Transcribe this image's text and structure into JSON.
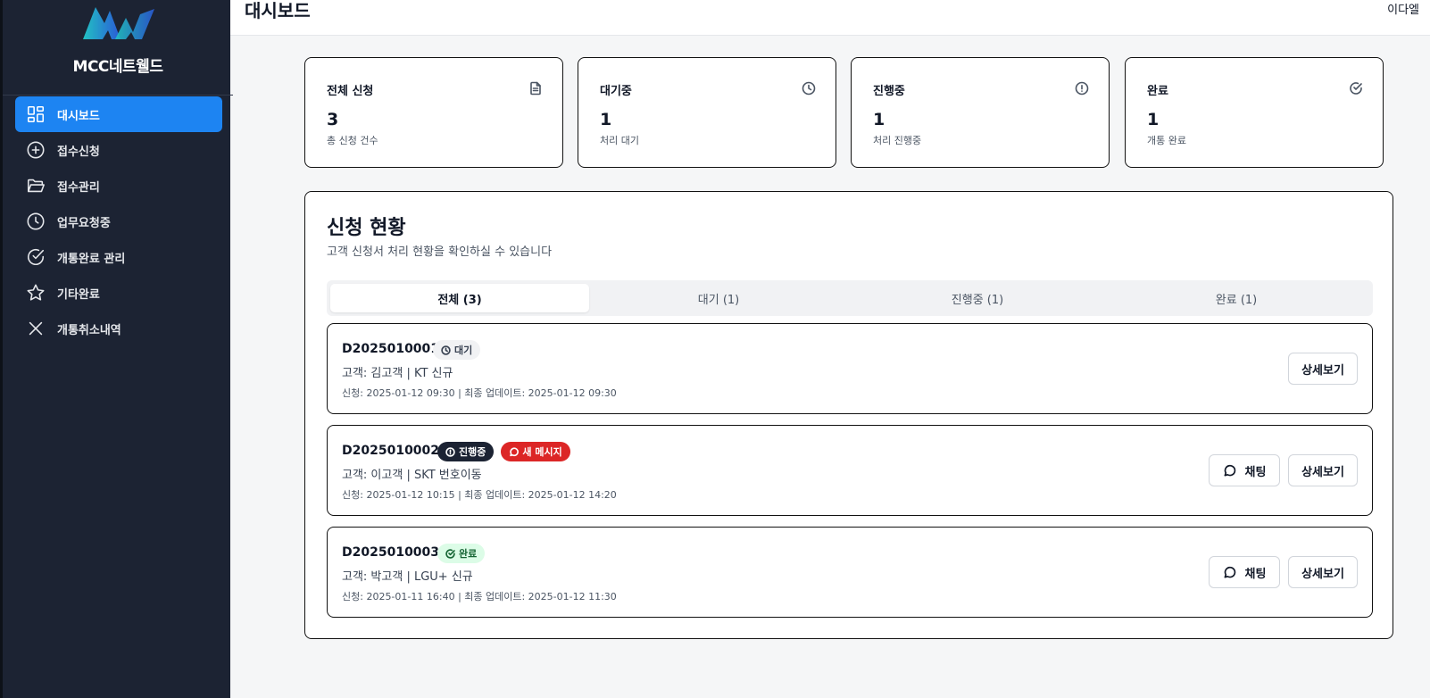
{
  "header": {
    "title": "대시보드",
    "user": "이다엘"
  },
  "sidebar": {
    "brand": "MCC네트웰드",
    "items": [
      {
        "label": "대시보드",
        "icon": "grid-icon",
        "active": true
      },
      {
        "label": "접수신청",
        "icon": "plus-circle-icon",
        "active": false
      },
      {
        "label": "접수관리",
        "icon": "folder-icon",
        "active": false
      },
      {
        "label": "업무요청중",
        "icon": "clock-icon",
        "active": false
      },
      {
        "label": "개통완료 관리",
        "icon": "check-circle-icon",
        "active": false
      },
      {
        "label": "기타완료",
        "icon": "star-icon",
        "active": false
      },
      {
        "label": "개통취소내역",
        "icon": "x-icon",
        "active": false
      }
    ]
  },
  "stats": [
    {
      "title": "전체 신청",
      "value": "3",
      "sub": "총 신청 건수",
      "icon": "document-icon"
    },
    {
      "title": "대기중",
      "value": "1",
      "sub": "처리 대기",
      "icon": "clock-icon"
    },
    {
      "title": "진행중",
      "value": "1",
      "sub": "처리 진행중",
      "icon": "alert-circle-icon"
    },
    {
      "title": "완료",
      "value": "1",
      "sub": "개통 완료",
      "icon": "check-circle-icon"
    }
  ],
  "panel": {
    "title": "신청 현황",
    "subtitle": "고객 신청서 처리 현황을 확인하실 수 있습니다",
    "tabs": [
      {
        "label": "전체 (3)",
        "active": true
      },
      {
        "label": "대기 (1)",
        "active": false
      },
      {
        "label": "진행중 (1)",
        "active": false
      },
      {
        "label": "완료 (1)",
        "active": false
      }
    ],
    "applications": [
      {
        "id": "D2025010001",
        "status": "대기",
        "new_message": "",
        "customer": "고객: 김고객 | KT 신규",
        "dates": "신청: 2025-01-12 09:30 | 최종 업데이트: 2025-01-12 09:30",
        "chat_label": "",
        "detail_label": "상세보기"
      },
      {
        "id": "D2025010002",
        "status": "진행중",
        "new_message": "새 메시지",
        "customer": "고객: 이고객 | SKT 번호이동",
        "dates": "신청: 2025-01-12 10:15 | 최종 업데이트: 2025-01-12 14:20",
        "chat_label": "채팅",
        "detail_label": "상세보기"
      },
      {
        "id": "D2025010003",
        "status": "완료",
        "new_message": "",
        "customer": "고객: 박고객 | LGU+ 신규",
        "dates": "신청: 2025-01-11 16:40 | 최종 업데이트: 2025-01-12 11:30",
        "chat_label": "채팅",
        "detail_label": "상세보기"
      }
    ]
  },
  "colors": {
    "sidebar_bg": "#1c2333",
    "accent": "#1d84f2",
    "new_message": "#dc2626",
    "done_badge_bg": "#dcfce7"
  }
}
